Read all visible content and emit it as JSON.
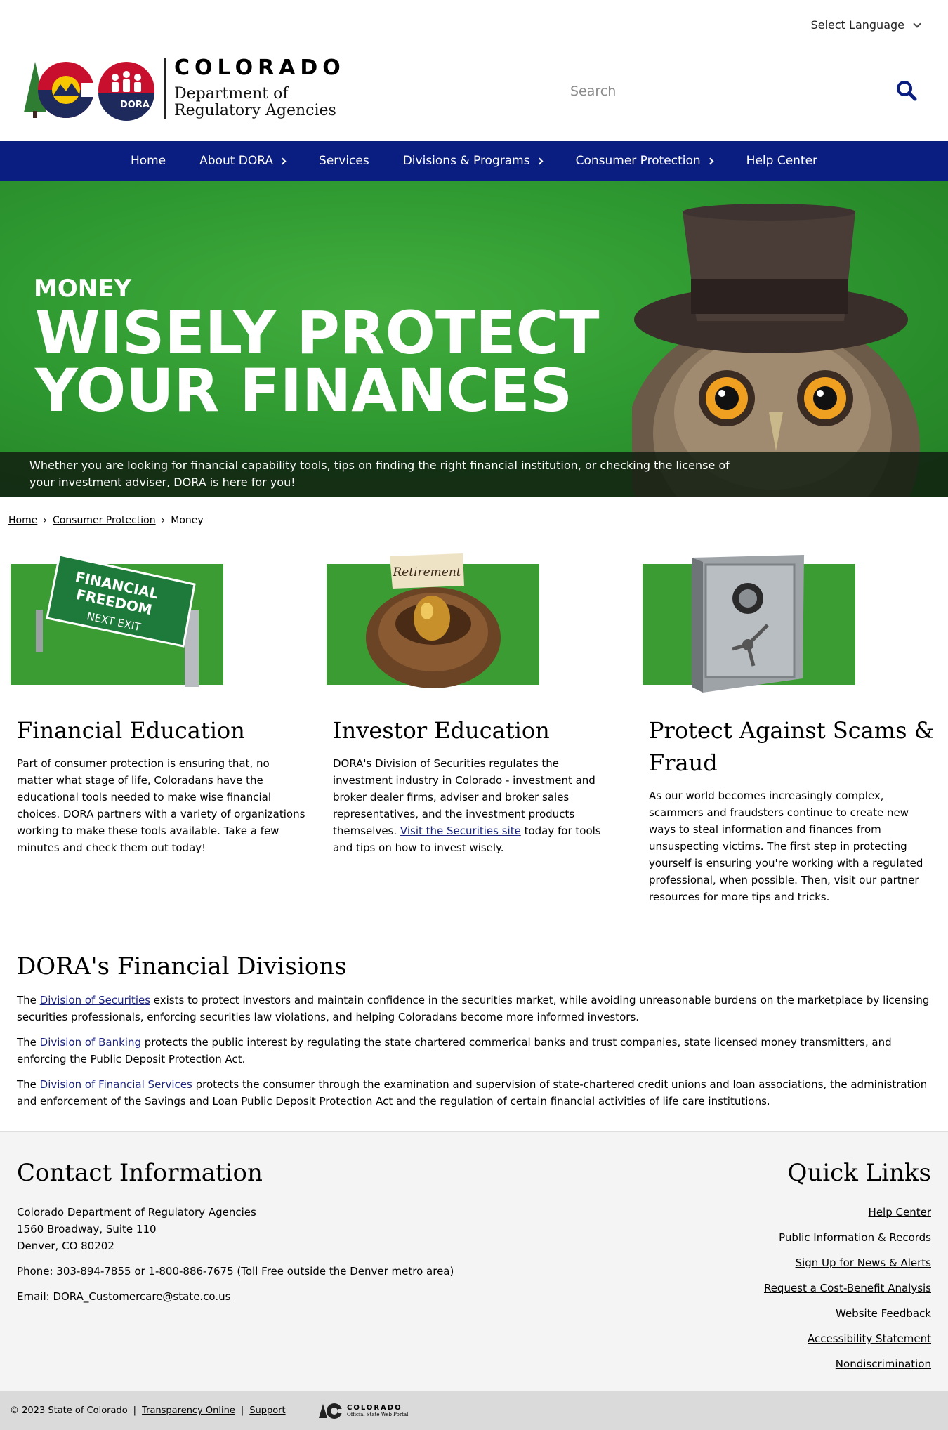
{
  "header": {
    "language_label": "Select Language",
    "logo_state": "COLORADO",
    "logo_dept_line1": "Department of",
    "logo_dept_line2": "Regulatory Agencies",
    "logo_badge": "DORA",
    "search_placeholder": "Search"
  },
  "nav": {
    "items": [
      {
        "label": "Home",
        "has_submenu": false
      },
      {
        "label": "About DORA",
        "has_submenu": true
      },
      {
        "label": "Services",
        "has_submenu": false
      },
      {
        "label": "Divisions & Programs",
        "has_submenu": true
      },
      {
        "label": "Consumer Protection",
        "has_submenu": true
      },
      {
        "label": "Help Center",
        "has_submenu": false
      }
    ]
  },
  "hero": {
    "kicker": "MONEY",
    "title_line1": "WISELY PROTECT",
    "title_line2": "YOUR FINANCES",
    "caption": "Whether you are looking for financial capability tools, tips on finding the right financial institution, or checking the license of your investment adviser, DORA is here for you!"
  },
  "breadcrumb": {
    "home": "Home",
    "consumer": "Consumer Protection",
    "current": "Money",
    "sep": "›"
  },
  "cards": [
    {
      "title": "Financial Education",
      "image_sign_line1": "FINANCIAL",
      "image_sign_line2": "FREEDOM",
      "image_sign_line3": "NEXT EXIT",
      "body": "Part of consumer protection is ensuring that, no matter what stage of life, Coloradans have the educational tools needed to make wise financial choices. DORA partners with a variety of organizations working to make these tools available. Take a few minutes and check them out today!"
    },
    {
      "title": "Investor Education",
      "image_label": "Retirement",
      "body_before": "DORA's Division of Securities regulates the investment industry in Colorado - investment and broker dealer firms, adviser and broker sales representatives, and the investment products themselves. ",
      "link": "Visit the Securities site",
      "body_after": " today for tools and tips on how to invest wisely."
    },
    {
      "title": "Protect Against Scams & Fraud",
      "body": "As our world becomes increasingly complex, scammers and fraudsters continue to create new ways to steal information and finances from unsuspecting victims. The first step in protecting yourself is ensuring you're working with a regulated professional, when possible. Then, visit our partner resources for more tips and tricks."
    }
  ],
  "divisions": {
    "heading": "DORA's Financial Divisions",
    "items": [
      {
        "prefix": "The ",
        "link": "Division of Securities",
        "text": " exists to protect investors and maintain confidence in the securities market, while avoiding unreasonable burdens on the marketplace by licensing securities professionals, enforcing securities law violations, and helping Coloradans become more informed investors."
      },
      {
        "prefix": "The ",
        "link": "Division of Banking",
        "text": " protects the public interest by regulating the state chartered commerical banks and trust companies, state licensed money transmitters, and enforcing the Public Deposit Protection Act."
      },
      {
        "prefix": "The ",
        "link": "Division of Financial Services",
        "text": " protects the consumer through the examination and supervision of state-chartered credit unions and loan associations, the administration and enforcement of the Savings and Loan Public Deposit Protection Act and the regulation of certain financial activities of life care institutions."
      }
    ]
  },
  "contact": {
    "heading": "Contact Information",
    "org": "Colorado Department of Regulatory Agencies",
    "street": "1560 Broadway, Suite 110",
    "city": "Denver, CO 80202",
    "phone": "Phone: 303-894-7855 or 1-800-886-7675 (Toll Free outside the Denver metro area)",
    "email_label": "Email: ",
    "email": "DORA_Customercare@state.co.us"
  },
  "quick_links": {
    "heading": "Quick Links",
    "items": [
      "Help Center",
      "Public Information & Records",
      "Sign Up for News & Alerts",
      "Request a Cost-Benefit Analysis",
      "Website Feedback",
      "Accessibility Statement",
      "Nondiscrimination"
    ]
  },
  "bottom_bar": {
    "copyright": "© 2023 State of Colorado",
    "sep": "|",
    "transparency": "Transparency Online",
    "support": "Support",
    "portal_line1": "COLORADO",
    "portal_line2": "Official State Web Portal"
  },
  "colors": {
    "nav_bg": "#0a1d81",
    "hero_green": "#2f9a31",
    "link_blue": "#1a237e",
    "logo_red": "#c8102e",
    "logo_navy": "#1f2a5c",
    "tree_green": "#2e7d32",
    "footer_bg": "#f4f4f4"
  }
}
